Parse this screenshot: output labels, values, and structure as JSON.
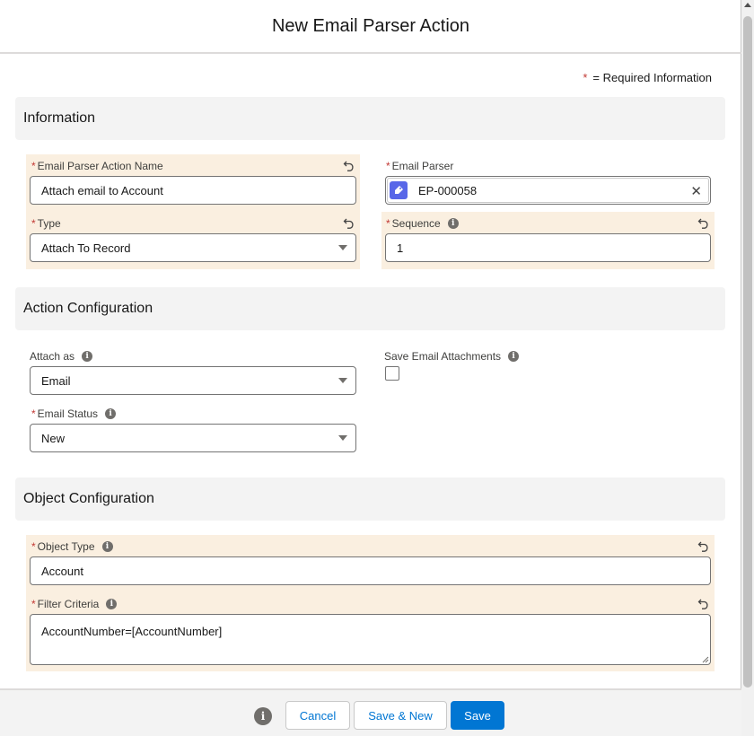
{
  "modal": {
    "title": "New Email Parser Action",
    "required_star": "*",
    "required_text": "= Required Information"
  },
  "sections": {
    "information": "Information",
    "action_config": "Action Configuration",
    "object_config": "Object Configuration"
  },
  "fields": {
    "action_name": {
      "label": "Email Parser Action Name",
      "value": "Attach email to Account",
      "required": "*"
    },
    "email_parser": {
      "label": "Email Parser",
      "value": "EP-000058",
      "required": "*"
    },
    "type": {
      "label": "Type",
      "value": "Attach To Record",
      "required": "*"
    },
    "sequence": {
      "label": "Sequence",
      "value": "1",
      "required": "*"
    },
    "attach_as": {
      "label": "Attach as",
      "value": "Email"
    },
    "save_attachments": {
      "label": "Save Email Attachments",
      "checked": false
    },
    "email_status": {
      "label": "Email Status",
      "value": "New",
      "required": "*"
    },
    "object_type": {
      "label": "Object Type",
      "value": "Account",
      "required": "*"
    },
    "filter_criteria": {
      "label": "Filter Criteria",
      "value": "AccountNumber=[AccountNumber]",
      "required": "*"
    }
  },
  "footer": {
    "cancel": "Cancel",
    "save_new": "Save & New",
    "save": "Save"
  },
  "colors": {
    "brand": "#0176d3",
    "changed_field_bg": "#faefe0",
    "required": "#c23934"
  },
  "icons": {
    "info": "i",
    "clear": "✕"
  }
}
